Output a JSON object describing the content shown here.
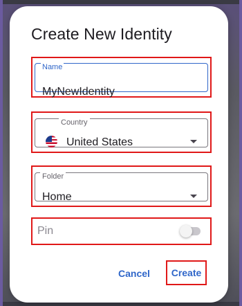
{
  "dialog": {
    "title": "Create New Identity"
  },
  "fields": {
    "name": {
      "label": "Name",
      "value": "MyNewIdentity"
    },
    "country": {
      "label": "Country",
      "value": "United States",
      "icon": "us-flag-icon"
    },
    "folder": {
      "label": "Folder",
      "value": "Home"
    },
    "pin": {
      "label": "Pin",
      "enabled": false
    }
  },
  "actions": {
    "cancel_label": "Cancel",
    "create_label": "Create"
  },
  "colors": {
    "accent": "#2f66c9",
    "highlight": "#e01818"
  }
}
